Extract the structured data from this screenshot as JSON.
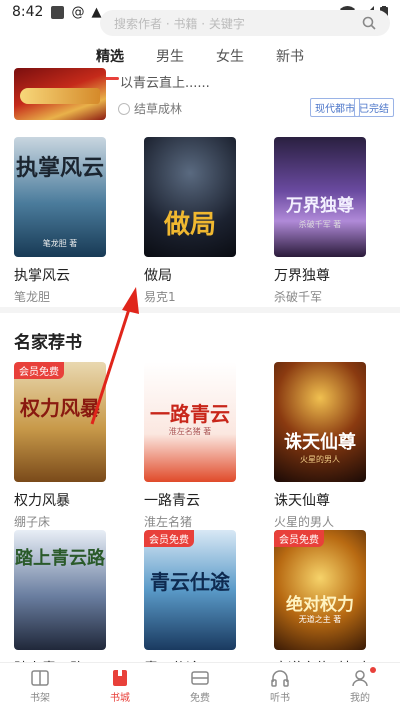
{
  "status_bar": {
    "time": "8:42"
  },
  "search": {
    "placeholder": "搜索作者 · 书籍 · 关键字"
  },
  "tabs": [
    {
      "label": "精选",
      "active": true
    },
    {
      "label": "男生",
      "active": false
    },
    {
      "label": "女生",
      "active": false
    },
    {
      "label": "新书",
      "active": false
    }
  ],
  "featured": {
    "description": "以青云直上......",
    "author": "结草成林",
    "tags": [
      "现代都市",
      "已完结"
    ]
  },
  "row1": [
    {
      "title": "执掌风云",
      "author": "笔龙胆",
      "cover_text": "执掌风云",
      "cover_sub": "笔龙胆 著"
    },
    {
      "title": "做局",
      "author": "易克1",
      "cover_text": "做局",
      "cover_sub": ""
    },
    {
      "title": "万界独尊",
      "author": "杀破千军",
      "cover_text": "万界独尊",
      "cover_sub": "杀破千军 著"
    }
  ],
  "section": {
    "title": "名家荐书"
  },
  "row2": [
    {
      "title": "权力风暴",
      "author": "绷子床",
      "badge": "会员免费",
      "cover_text": "权力风暴"
    },
    {
      "title": "一路青云",
      "author": "淮左名猪",
      "badge": "",
      "cover_text": "一路青云",
      "cover_sub": "淮左名猪 著"
    },
    {
      "title": "诛天仙尊",
      "author": "火星的男人",
      "badge": "",
      "cover_text": "诛天仙尊",
      "cover_sub": "火星的男人"
    }
  ],
  "row3": [
    {
      "title": "踏上青云路",
      "badge": "",
      "cover_text": "踏上青云路"
    },
    {
      "title": "青云仕途",
      "badge": "会员免费",
      "cover_text": "青云仕途"
    },
    {
      "title": "官道之绝对权力",
      "badge": "会员免费",
      "cover_text": "绝对权力",
      "cover_sub": "无道之主 著"
    }
  ],
  "bottom_nav": [
    {
      "label": "书架",
      "active": false,
      "icon": "bookshelf-icon"
    },
    {
      "label": "书城",
      "active": true,
      "icon": "bookstore-icon"
    },
    {
      "label": "免费",
      "active": false,
      "icon": "free-icon"
    },
    {
      "label": "听书",
      "active": false,
      "icon": "headphones-icon"
    },
    {
      "label": "我的",
      "active": false,
      "icon": "profile-icon"
    }
  ],
  "colors": {
    "accent": "#e8403a",
    "tag_blue": "#4a74c8"
  }
}
